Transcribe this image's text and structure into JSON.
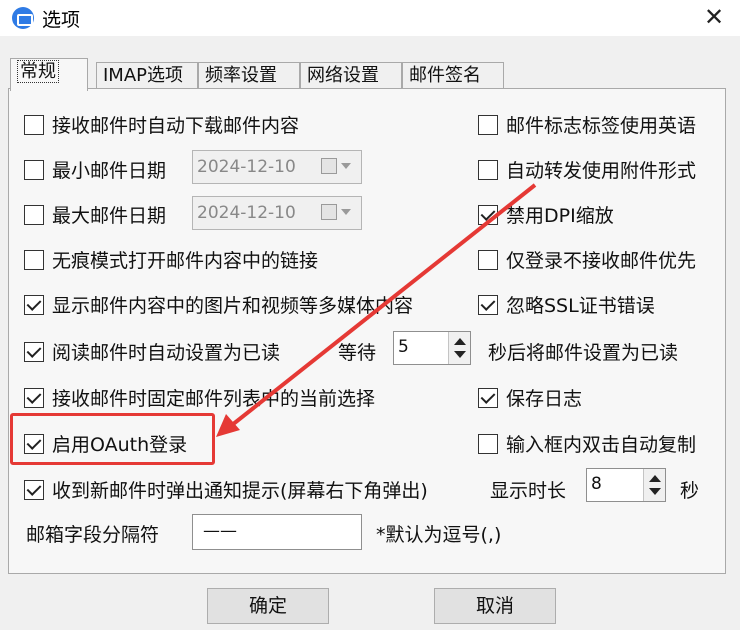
{
  "window": {
    "title": "选项",
    "close": "✕"
  },
  "tabs": [
    {
      "label": "常规"
    },
    {
      "label": "IMAP选项"
    },
    {
      "label": "频率设置"
    },
    {
      "label": "网络设置"
    },
    {
      "label": "邮件签名"
    }
  ],
  "left_options": [
    {
      "label": "接收邮件时自动下载邮件内容",
      "checked": false
    },
    {
      "label": "最小邮件日期",
      "checked": false
    },
    {
      "label": "最大邮件日期",
      "checked": false
    },
    {
      "label": "无痕模式打开邮件内容中的链接",
      "checked": false
    },
    {
      "label": "显示邮件内容中的图片和视频等多媒体内容",
      "checked": true
    },
    {
      "label": "阅读邮件时自动设置为已读",
      "checked": true
    },
    {
      "label": "接收邮件时固定邮件列表中的当前选择",
      "checked": true
    },
    {
      "label": "启用OAuth登录",
      "checked": true
    },
    {
      "label": "收到新邮件时弹出通知提示(屏幕右下角弹出)",
      "checked": true
    }
  ],
  "right_options": [
    {
      "label": "邮件标志标签使用英语",
      "checked": false
    },
    {
      "label": "自动转发使用附件形式",
      "checked": false
    },
    {
      "label": "禁用DPI缩放",
      "checked": true
    },
    {
      "label": "仅登录不接收邮件优先",
      "checked": false
    },
    {
      "label": "忽略SSL证书错误",
      "checked": true
    },
    {
      "label": "保存日志",
      "checked": true
    },
    {
      "label": "输入框内双击自动复制",
      "checked": false
    }
  ],
  "min_date": "2024-12-10",
  "max_date": "2024-12-10",
  "read_wait": {
    "label": "等待",
    "value": "5",
    "suffix": "秒后将邮件设置为已读"
  },
  "notify_duration": {
    "label": "显示时长",
    "value": "8",
    "suffix": "秒"
  },
  "separator": {
    "label": "邮箱字段分隔符",
    "value": "——",
    "hint": "*默认为逗号(,)"
  },
  "buttons": {
    "ok": "确定",
    "cancel": "取消"
  },
  "colors": {
    "highlight": "#e53935",
    "title_bar": "#ffffff",
    "dialog_bg": "#f0f0f0"
  }
}
